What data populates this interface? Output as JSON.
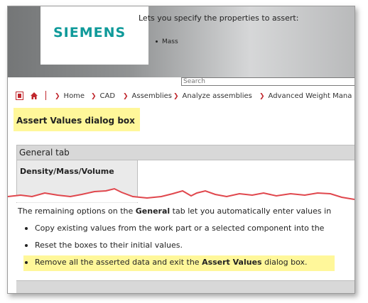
{
  "header": {
    "logo_text": "SIEMENS"
  },
  "search": {
    "placeholder": "Search"
  },
  "breadcrumb": {
    "items": [
      "Home",
      "CAD",
      "Assemblies",
      "Analyze assemblies",
      "Advanced Weight Mana"
    ]
  },
  "page": {
    "title": "Assert Values dialog box"
  },
  "general_tab": {
    "heading_bold": "General",
    "heading_rest": " tab",
    "row_label": "Density/Mass/Volume",
    "row_text": "Lets you specify the properties to assert:",
    "row_item": "Mass"
  },
  "body": {
    "remaining_pre": "The remaining options on the ",
    "remaining_bold": "General",
    "remaining_post": " tab let you automatically enter values in",
    "bullets": [
      "Copy existing values from the work part or a selected component into the",
      "Reset the boxes to their initial values."
    ],
    "bullet3_pre": "Remove all the asserted data and exit the ",
    "bullet3_bold": "Assert Values",
    "bullet3_post": " dialog box."
  },
  "colors": {
    "accent_red": "#c0272d",
    "siemens_teal": "#0f9a9a",
    "highlight": "#fff79a"
  }
}
